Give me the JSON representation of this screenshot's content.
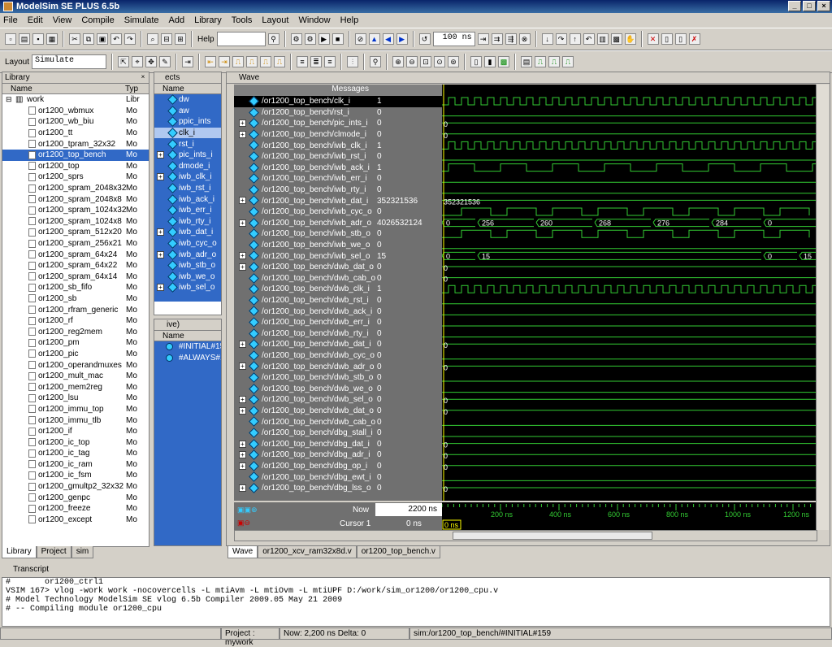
{
  "title": "ModelSim SE PLUS 6.5b",
  "menu": [
    "File",
    "Edit",
    "View",
    "Compile",
    "Simulate",
    "Add",
    "Library",
    "Tools",
    "Layout",
    "Window",
    "Help"
  ],
  "toolbar": {
    "help_label": "Help",
    "run_length": "100 ns",
    "layout_label": "Layout",
    "layout_value": "Simulate"
  },
  "library": {
    "title": "Library",
    "col_name": "Name",
    "col_type": "Typ",
    "root": "work",
    "root_type": "Libr",
    "items": [
      [
        "or1200_wbmux",
        "Mo"
      ],
      [
        "or1200_wb_biu",
        "Mo"
      ],
      [
        "or1200_tt",
        "Mo"
      ],
      [
        "or1200_tpram_32x32",
        "Mo"
      ],
      [
        "or1200_top_bench",
        "Mo"
      ],
      [
        "or1200_top",
        "Mo"
      ],
      [
        "or1200_sprs",
        "Mo"
      ],
      [
        "or1200_spram_2048x32",
        "Mo"
      ],
      [
        "or1200_spram_2048x8",
        "Mo"
      ],
      [
        "or1200_spram_1024x32",
        "Mo"
      ],
      [
        "or1200_spram_1024x8",
        "Mo"
      ],
      [
        "or1200_spram_512x20",
        "Mo"
      ],
      [
        "or1200_spram_256x21",
        "Mo"
      ],
      [
        "or1200_spram_64x24",
        "Mo"
      ],
      [
        "or1200_spram_64x22",
        "Mo"
      ],
      [
        "or1200_spram_64x14",
        "Mo"
      ],
      [
        "or1200_sb_fifo",
        "Mo"
      ],
      [
        "or1200_sb",
        "Mo"
      ],
      [
        "or1200_rfram_generic",
        "Mo"
      ],
      [
        "or1200_rf",
        "Mo"
      ],
      [
        "or1200_reg2mem",
        "Mo"
      ],
      [
        "or1200_pm",
        "Mo"
      ],
      [
        "or1200_pic",
        "Mo"
      ],
      [
        "or1200_operandmuxes",
        "Mo"
      ],
      [
        "or1200_mult_mac",
        "Mo"
      ],
      [
        "or1200_mem2reg",
        "Mo"
      ],
      [
        "or1200_lsu",
        "Mo"
      ],
      [
        "or1200_immu_top",
        "Mo"
      ],
      [
        "or1200_immu_tlb",
        "Mo"
      ],
      [
        "or1200_if",
        "Mo"
      ],
      [
        "or1200_ic_top",
        "Mo"
      ],
      [
        "or1200_ic_tag",
        "Mo"
      ],
      [
        "or1200_ic_ram",
        "Mo"
      ],
      [
        "or1200_ic_fsm",
        "Mo"
      ],
      [
        "or1200_gmultp2_32x32",
        "Mo"
      ],
      [
        "or1200_genpc",
        "Mo"
      ],
      [
        "or1200_freeze",
        "Mo"
      ],
      [
        "or1200_except",
        "Mo"
      ]
    ],
    "tabs": [
      "Library",
      "Project",
      "sim"
    ]
  },
  "objects": {
    "title": "ects",
    "col_name": "Name",
    "items": [
      "dw",
      "aw",
      "ppic_ints",
      "clk_i",
      "rst_i",
      "pic_ints_i",
      "dmode_i",
      "iwb_clk_i",
      "iwb_rst_i",
      "iwb_ack_i",
      "iwb_err_i",
      "iwb_rty_i",
      "iwb_dat_i",
      "iwb_cyc_o",
      "iwb_adr_o",
      "iwb_stb_o",
      "iwb_we_o",
      "iwb_sel_o"
    ]
  },
  "processes": {
    "title": "ive)",
    "col_name": "Name",
    "items": [
      "#INITIAL#15",
      "#ALWAYS#1"
    ]
  },
  "wave": {
    "title": "Wave",
    "messages_label": "Messages",
    "signals": [
      [
        "/or1200_top_bench/clk_i",
        "1"
      ],
      [
        "/or1200_top_bench/rst_i",
        "0"
      ],
      [
        "/or1200_top_bench/pic_ints_i",
        "0"
      ],
      [
        "/or1200_top_bench/clmode_i",
        "0"
      ],
      [
        "/or1200_top_bench/iwb_clk_i",
        "1"
      ],
      [
        "/or1200_top_bench/iwb_rst_i",
        "0"
      ],
      [
        "/or1200_top_bench/iwb_ack_i",
        "1"
      ],
      [
        "/or1200_top_bench/iwb_err_i",
        "0"
      ],
      [
        "/or1200_top_bench/iwb_rty_i",
        "0"
      ],
      [
        "/or1200_top_bench/iwb_dat_i",
        "352321536"
      ],
      [
        "/or1200_top_bench/iwb_cyc_o",
        "0"
      ],
      [
        "/or1200_top_bench/iwb_adr_o",
        "4026532124"
      ],
      [
        "/or1200_top_bench/iwb_stb_o",
        "0"
      ],
      [
        "/or1200_top_bench/iwb_we_o",
        "0"
      ],
      [
        "/or1200_top_bench/iwb_sel_o",
        "15"
      ],
      [
        "/or1200_top_bench/dwb_dat_o",
        "0"
      ],
      [
        "/or1200_top_bench/dwb_cab_o",
        "0"
      ],
      [
        "/or1200_top_bench/dwb_clk_i",
        "1"
      ],
      [
        "/or1200_top_bench/dwb_rst_i",
        "0"
      ],
      [
        "/or1200_top_bench/dwb_ack_i",
        "0"
      ],
      [
        "/or1200_top_bench/dwb_err_i",
        "0"
      ],
      [
        "/or1200_top_bench/dwb_rty_i",
        "0"
      ],
      [
        "/or1200_top_bench/dwb_dat_i",
        "0"
      ],
      [
        "/or1200_top_bench/dwb_cyc_o",
        "0"
      ],
      [
        "/or1200_top_bench/dwb_adr_o",
        "0"
      ],
      [
        "/or1200_top_bench/dwb_stb_o",
        "0"
      ],
      [
        "/or1200_top_bench/dwb_we_o",
        "0"
      ],
      [
        "/or1200_top_bench/dwb_sel_o",
        "0"
      ],
      [
        "/or1200_top_bench/dwb_dat_o",
        "0"
      ],
      [
        "/or1200_top_bench/dwb_cab_o",
        "0"
      ],
      [
        "/or1200_top_bench/dbg_stall_i",
        "0"
      ],
      [
        "/or1200_top_bench/dbg_dat_i",
        "0"
      ],
      [
        "/or1200_top_bench/dbg_adr_i",
        "0"
      ],
      [
        "/or1200_top_bench/dbg_op_i",
        "0"
      ],
      [
        "/or1200_top_bench/dbg_ewt_i",
        "0"
      ],
      [
        "/or1200_top_bench/dbg_lss_o",
        "0"
      ]
    ],
    "bus_labels": {
      "dat": "352321536",
      "adr": [
        "0",
        "256",
        "260",
        "268",
        "276",
        "284",
        "0"
      ],
      "sel": [
        "0",
        "15",
        "0",
        "15"
      ]
    },
    "zero": "0",
    "now_label": "Now",
    "now_value": "2200 ns",
    "cursor_label": "Cursor 1",
    "cursor_value": "0 ns",
    "cursor_flag": "0 ns",
    "time_ticks": [
      "200 ns",
      "400 ns",
      "600 ns",
      "800 ns",
      "1000 ns",
      "1200 ns"
    ],
    "tabs": [
      "Wave",
      "or1200_xcv_ram32x8d.v",
      "or1200_top_bench.v"
    ]
  },
  "transcript": {
    "title": "Transcript",
    "lines": [
      "#       or1200_ctrl1",
      "VSIM 167> vlog -work work -nocovercells -L mtiAvm -L mtiOvm -L mtiUPF D:/work/sim_or1200/or1200_cpu.v",
      "# Model Technology ModelSim SE vlog 6.5b Compiler 2009.05 May 21 2009",
      "# -- Compiling module or1200_cpu"
    ]
  },
  "status": {
    "project": "Project : mywork",
    "now": "Now: 2,200 ns  Delta: 0",
    "context": "sim:/or1200_top_bench/#INITIAL#159"
  }
}
